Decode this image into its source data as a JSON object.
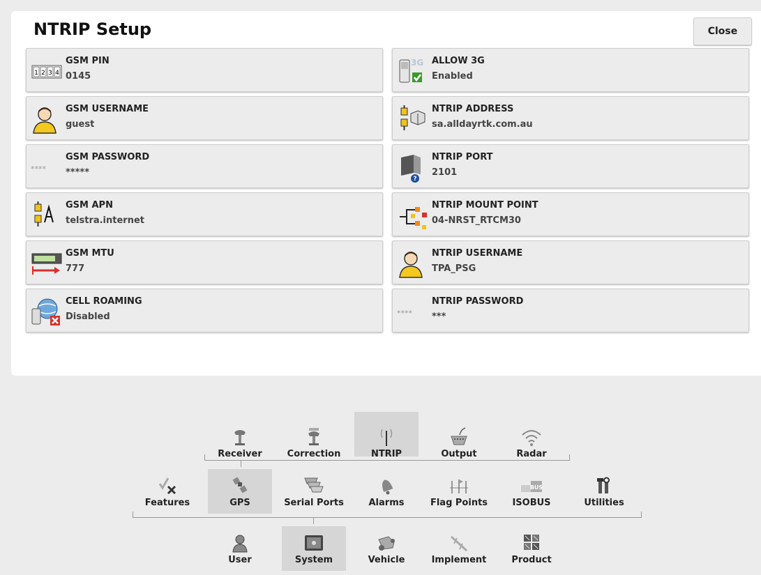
{
  "title": "NTRIP Setup",
  "close_label": "Close",
  "left_tiles": [
    {
      "label": "GSM PIN",
      "value": "0145",
      "icon": "keypad-icon"
    },
    {
      "label": "GSM USERNAME",
      "value": "guest",
      "icon": "user-icon"
    },
    {
      "label": "GSM PASSWORD",
      "value": "*****",
      "icon": "password-icon"
    },
    {
      "label": "GSM APN",
      "value": "telstra.internet",
      "icon": "apn-icon"
    },
    {
      "label": "GSM MTU",
      "value": "777",
      "icon": "mtu-icon"
    },
    {
      "label": "CELL ROAMING",
      "value": "Disabled",
      "icon": "roaming-icon"
    }
  ],
  "right_tiles": [
    {
      "label": "ALLOW 3G",
      "value": "Enabled",
      "icon": "phone-3g-icon",
      "icon_text": "3G"
    },
    {
      "label": "NTRIP ADDRESS",
      "value": "sa.alldayrtk.com.au",
      "icon": "address-icon"
    },
    {
      "label": "NTRIP PORT",
      "value": "2101",
      "icon": "port-icon"
    },
    {
      "label": "NTRIP MOUNT POINT",
      "value": "04-NRST_RTCM30",
      "icon": "mount-point-icon"
    },
    {
      "label": "NTRIP USERNAME",
      "value": "TPA_PSG",
      "icon": "user-icon"
    },
    {
      "label": "NTRIP PASSWORD",
      "value": "***",
      "icon": "password-icon"
    }
  ],
  "nav_row1": [
    {
      "label": "Receiver",
      "icon": "receiver-icon",
      "selected": false
    },
    {
      "label": "Correction",
      "icon": "correction-icon",
      "selected": false
    },
    {
      "label": "NTRIP",
      "icon": "antenna-icon",
      "selected": true
    },
    {
      "label": "Output",
      "icon": "output-icon",
      "selected": false
    },
    {
      "label": "Radar",
      "icon": "radar-icon",
      "selected": false
    }
  ],
  "nav_row2": [
    {
      "label": "Features",
      "icon": "features-icon",
      "selected": false
    },
    {
      "label": "GPS",
      "icon": "satellite-icon",
      "selected": true
    },
    {
      "label": "Serial Ports",
      "icon": "serial-ports-icon",
      "selected": false
    },
    {
      "label": "Alarms",
      "icon": "alarm-bell-icon",
      "selected": false
    },
    {
      "label": "Flag Points",
      "icon": "flag-points-icon",
      "selected": false
    },
    {
      "label": "ISOBUS",
      "icon": "isobus-icon",
      "icon_text": "BUS",
      "selected": false
    },
    {
      "label": "Utilities",
      "icon": "utilities-icon",
      "selected": false
    }
  ],
  "nav_row3": [
    {
      "label": "User",
      "icon": "user-icon",
      "selected": false
    },
    {
      "label": "System",
      "icon": "system-icon",
      "selected": true
    },
    {
      "label": "Vehicle",
      "icon": "vehicle-icon",
      "selected": false
    },
    {
      "label": "Implement",
      "icon": "implement-icon",
      "selected": false
    },
    {
      "label": "Product",
      "icon": "product-icon",
      "selected": false
    }
  ],
  "colors": {
    "background": "#ececec",
    "panel": "#ffffff",
    "tile": "#ececec",
    "selected": "#d6d6d6",
    "check_green": "#3a9a2a",
    "error_red": "#d9302c"
  }
}
